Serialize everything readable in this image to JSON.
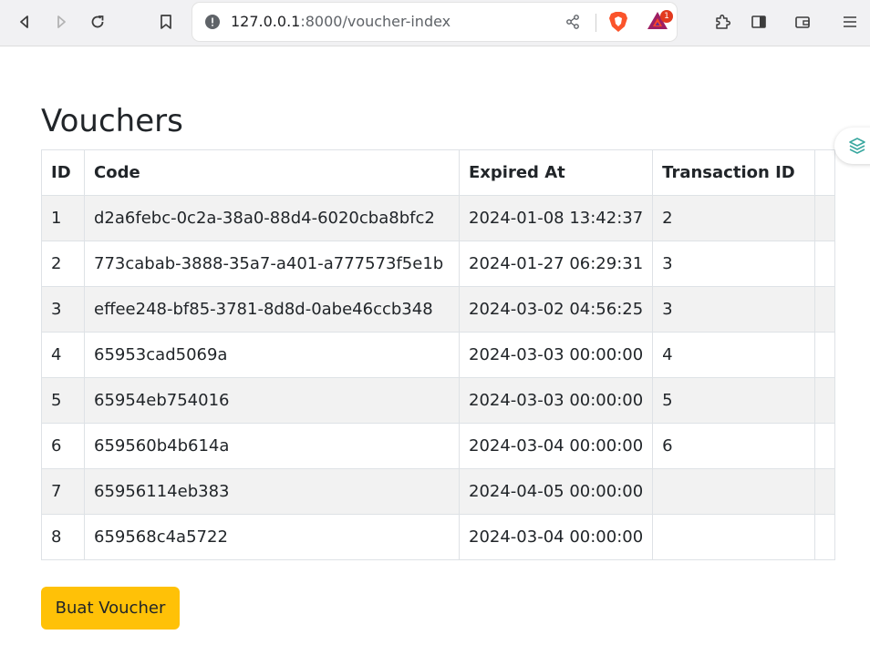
{
  "browser": {
    "url_host": "127.0.0.1",
    "url_rest": ":8000/voucher-index",
    "bat_badge": "1"
  },
  "page": {
    "title": "Vouchers"
  },
  "table": {
    "headers": {
      "id": "ID",
      "code": "Code",
      "expired_at": "Expired At",
      "transaction_id": "Transaction ID"
    },
    "rows": [
      {
        "id": "1",
        "code": "d2a6febc-0c2a-38a0-88d4-6020cba8bfc2",
        "expired_at": "2024-01-08 13:42:37",
        "transaction_id": "2"
      },
      {
        "id": "2",
        "code": "773cabab-3888-35a7-a401-a777573f5e1b",
        "expired_at": "2024-01-27 06:29:31",
        "transaction_id": "3"
      },
      {
        "id": "3",
        "code": "effee248-bf85-3781-8d8d-0abe46ccb348",
        "expired_at": "2024-03-02 04:56:25",
        "transaction_id": "3"
      },
      {
        "id": "4",
        "code": "65953cad5069a",
        "expired_at": "2024-03-03 00:00:00",
        "transaction_id": "4"
      },
      {
        "id": "5",
        "code": "65954eb754016",
        "expired_at": "2024-03-03 00:00:00",
        "transaction_id": "5"
      },
      {
        "id": "6",
        "code": "659560b4b614a",
        "expired_at": "2024-03-04 00:00:00",
        "transaction_id": "6"
      },
      {
        "id": "7",
        "code": "65956114eb383",
        "expired_at": "2024-04-05 00:00:00",
        "transaction_id": ""
      },
      {
        "id": "8",
        "code": "659568c4a5722",
        "expired_at": "2024-03-04 00:00:00",
        "transaction_id": ""
      }
    ]
  },
  "actions": {
    "create_label": "Buat Voucher"
  },
  "colors": {
    "button": "#ffc107",
    "row_stripe": "#f2f2f2",
    "border": "#dee2e6"
  }
}
